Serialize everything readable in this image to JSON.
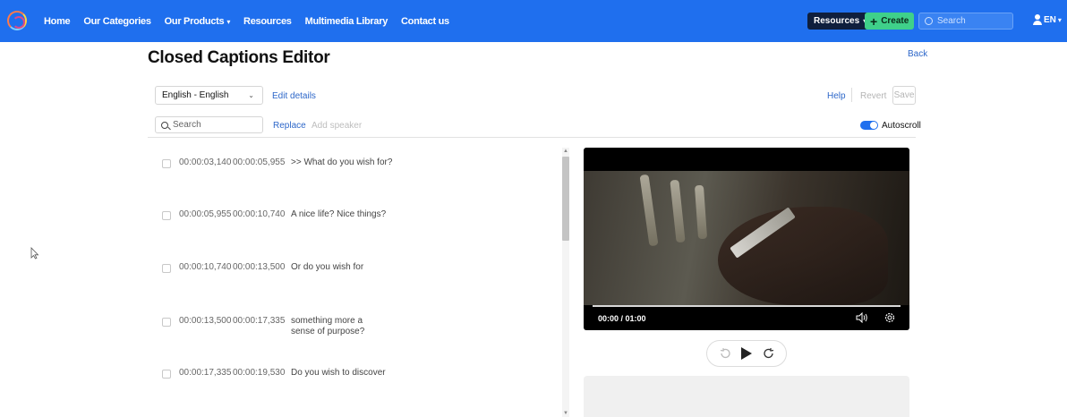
{
  "nav": {
    "links": [
      {
        "label": "Home"
      },
      {
        "label": "Our Categories"
      },
      {
        "label": "Our Products",
        "caret": "⌄"
      },
      {
        "label": "Resources"
      },
      {
        "label": "Multimedia Library"
      },
      {
        "label": "Contact us"
      }
    ],
    "resources_button": "Resources",
    "create_button": "Create",
    "search_placeholder": "Search",
    "language": "EN",
    "accent_color": "#1f6fee",
    "create_color": "#3fd08a"
  },
  "page": {
    "title": "Closed Captions Editor",
    "back_label": "Back"
  },
  "toolbar": {
    "language_value": "English - English",
    "edit_details_label": "Edit details",
    "help_label": "Help",
    "revert_label": "Revert",
    "save_label": "Save",
    "search_placeholder": "Search",
    "replace_label": "Replace",
    "add_speaker_label": "Add speaker",
    "autoscroll_label": "Autoscroll",
    "autoscroll_on": true
  },
  "captions": [
    {
      "start": "00:00:03,140",
      "end": "00:00:05,955",
      "text": ">> What do you wish for?"
    },
    {
      "start": "00:00:05,955",
      "end": "00:00:10,740",
      "text": "A nice life? Nice things?"
    },
    {
      "start": "00:00:10,740",
      "end": "00:00:13,500",
      "text": "Or do you wish for"
    },
    {
      "start": "00:00:13,500",
      "end": "00:00:17,335",
      "text": "something more a\nsense of purpose?"
    },
    {
      "start": "00:00:17,335",
      "end": "00:00:19,530",
      "text": "Do you wish to discover"
    }
  ],
  "player": {
    "time": "00:00 / 01:00",
    "progress": 0
  }
}
